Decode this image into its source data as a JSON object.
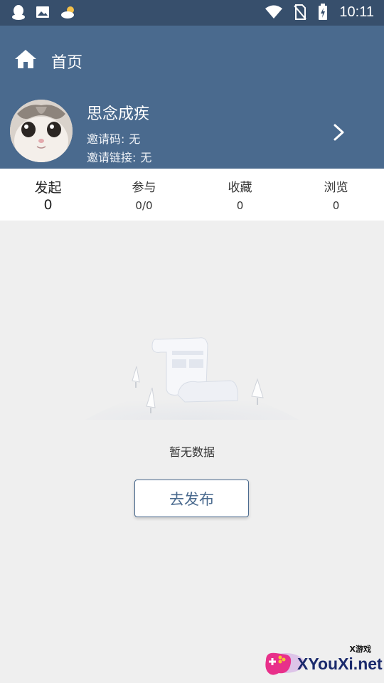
{
  "status_bar": {
    "time": "10:11"
  },
  "header": {
    "title": "首页",
    "user": {
      "name": "思念成疾",
      "invite_code_label": "邀请码:",
      "invite_code_value": "无",
      "invite_link_label": "邀请链接:",
      "invite_link_value": "无"
    }
  },
  "stats": [
    {
      "label": "发起",
      "value": "0"
    },
    {
      "label": "参与",
      "value": "0/0"
    },
    {
      "label": "收藏",
      "value": "0"
    },
    {
      "label": "浏览",
      "value": "0"
    }
  ],
  "empty_state": {
    "text": "暂无数据",
    "button_label": "去发布"
  },
  "watermark": {
    "small": "X游戏",
    "big": "XYouXi.net"
  },
  "colors": {
    "header_bg": "#4a6a8e",
    "status_bg": "#374f6c",
    "accent": "#4a6a8e",
    "page_bg": "#efefef"
  }
}
